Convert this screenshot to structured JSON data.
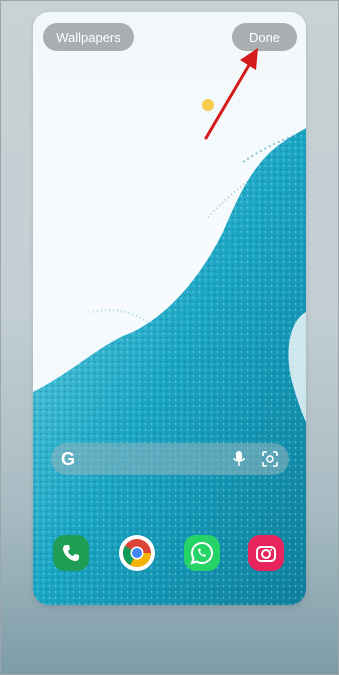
{
  "header": {
    "wallpapers_label": "Wallpapers",
    "done_label": "Done"
  },
  "search": {
    "logo": "G",
    "mic_icon": "mic-icon",
    "lens_icon": "lens-icon"
  },
  "dock": {
    "apps": [
      {
        "icon": "phone-icon",
        "color": "#1f9d55"
      },
      {
        "icon": "chrome-icon",
        "color": "#ffffff"
      },
      {
        "icon": "whatsapp-icon",
        "color": "#25d366"
      },
      {
        "icon": "camera-icon",
        "color": "#e8245d"
      }
    ]
  },
  "colors": {
    "pill_bg": "#a9aeb1",
    "annotation_arrow": "#d41a1a",
    "wallpaper_accent": "#1aa6c4"
  }
}
